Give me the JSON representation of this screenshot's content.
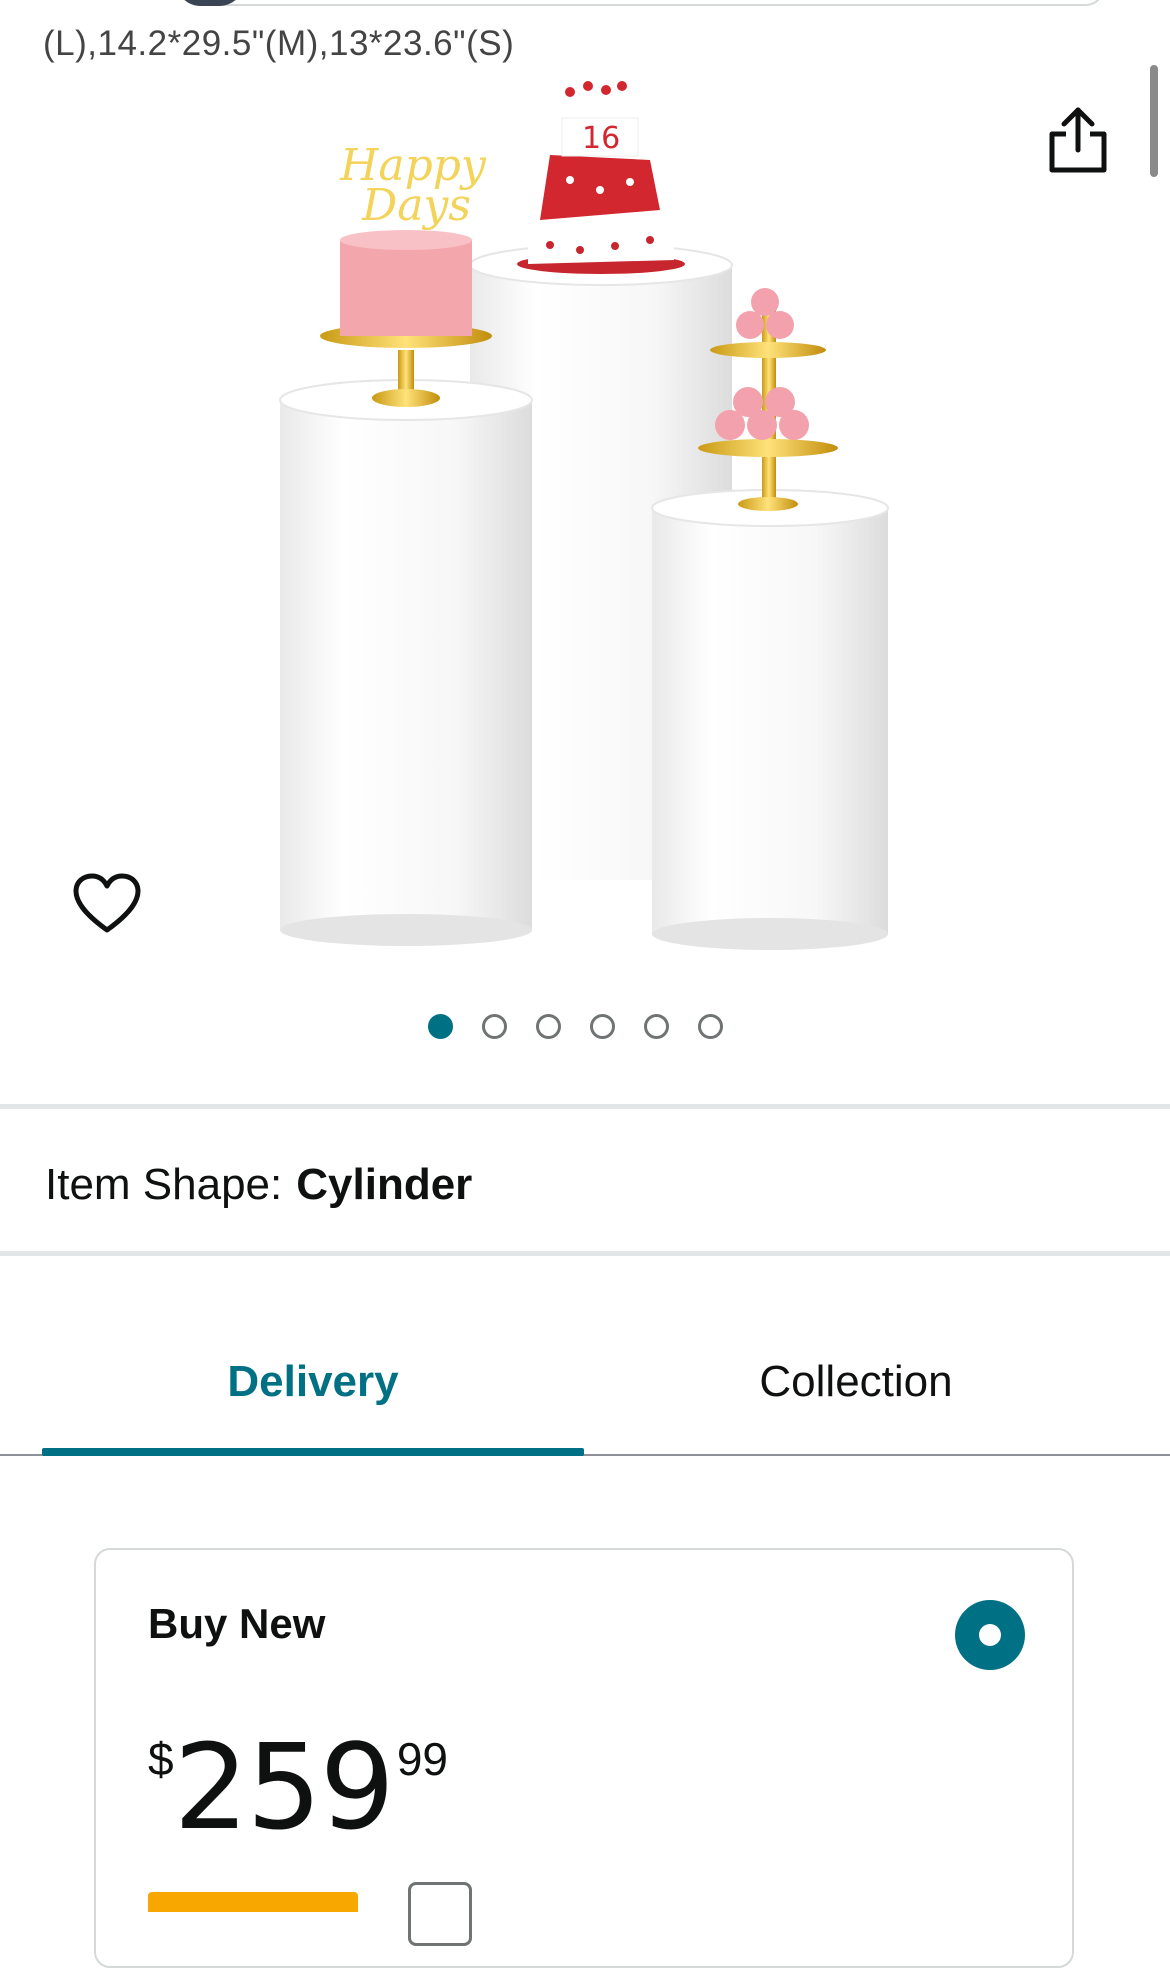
{
  "product": {
    "size_line": "(L),14.2*29.5\"(M),13*23.6\"(S)",
    "image": {
      "topper_text": "Happy Days",
      "cake_number": "16",
      "alt_label": "Product image"
    },
    "image_count": 6,
    "active_image_index": 0
  },
  "icons": {
    "share": "share-icon",
    "wishlist": "heart-icon"
  },
  "item_shape": {
    "label": "Item Shape:",
    "value": "Cylinder"
  },
  "tabs": [
    {
      "label": "Delivery",
      "active": true
    },
    {
      "label": "Collection",
      "active": false
    }
  ],
  "buy_box": {
    "title": "Buy New",
    "selected": true,
    "price": {
      "symbol": "$",
      "whole": "259",
      "fraction": "99"
    }
  },
  "colors": {
    "accent": "#007185",
    "text": "#0f1111",
    "button_orange": "#f7a700"
  }
}
